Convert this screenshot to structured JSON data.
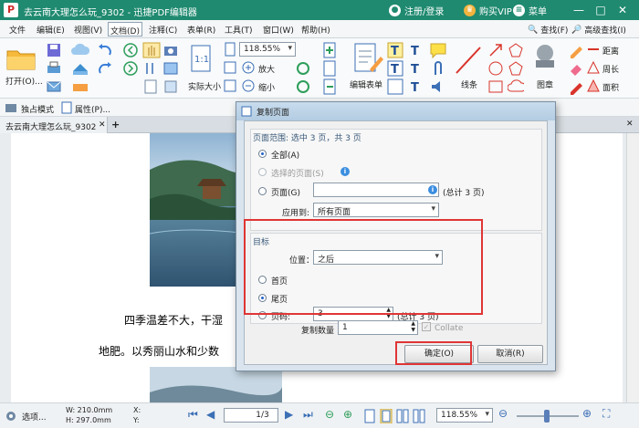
{
  "titlebar": {
    "logo_text": "P",
    "doc_title": "去云南大理怎么玩_9302",
    "app_name": "迅捷PDF编辑器",
    "user_label": "注册/登录",
    "vip_label": "购买VIP",
    "menu_label": "菜单"
  },
  "menubar": {
    "items": [
      "文件",
      "编辑(E)",
      "视图(V)",
      "文档(D)",
      "注释(C)",
      "表单(R)",
      "工具(T)",
      "窗口(W)",
      "帮助(H)"
    ],
    "find_label": "查找(F)",
    "adv_find_label": "高级查找(I)"
  },
  "ribbon": {
    "open_label": "打开(O)...",
    "zoom_value": "118.55%",
    "actual_size_label": "实际大小",
    "zoom_in_label": "放大",
    "zoom_out_label": "缩小",
    "edit_form_label": "编辑表单",
    "line_label": "线条",
    "stamp_label": "图章",
    "distance_label": "距离",
    "perimeter_label": "周长",
    "area_label": "面积"
  },
  "toolbar2": {
    "mode_label": "独占模式",
    "props_label": "属性(P)..."
  },
  "tab": {
    "label": "去云南大理怎么玩_9302"
  },
  "doc": {
    "line1": "四季温差不大，干湿",
    "line2": "地肥。以秀丽山水和少数"
  },
  "dialog": {
    "title": "复制页面",
    "range_head": "页面范围: 选中 3 页，共 3 页",
    "opt_all": "全部(A)",
    "opt_selected": "选择的页面(S)",
    "opt_pages": "页面(G)",
    "pages_total": "(总计 3 页)",
    "apply_label": "应用到:",
    "apply_value": "所有页面",
    "target_head": "目标",
    "position_label": "位置：",
    "position_value": "之后",
    "opt_first": "首页",
    "opt_last": "尾页",
    "opt_pageno": "页码:",
    "pageno_value": "3",
    "pageno_total": "(总计 3 页)",
    "copies_label": "复制数量",
    "copies_value": "1",
    "collate_label": "Collate",
    "ok_label": "确定(O)",
    "cancel_label": "取消(R)"
  },
  "statusbar": {
    "options_label": "选项...",
    "width": "W: 210.0mm",
    "height": "H: 297.0mm",
    "x_label": "X:",
    "y_label": "Y:",
    "page_input": "1",
    "page_total": "/3",
    "zoom_value": "118.55%"
  }
}
